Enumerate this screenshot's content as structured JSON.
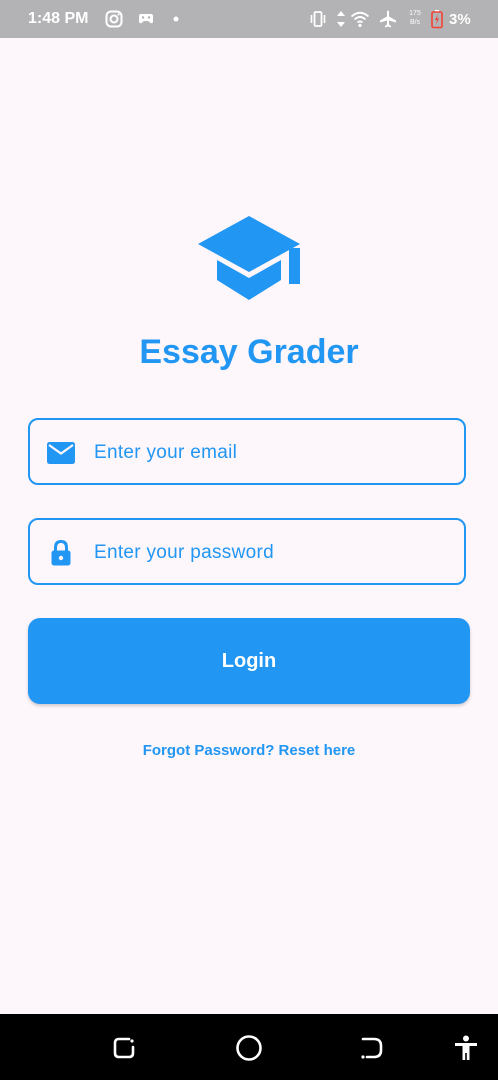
{
  "status_bar": {
    "time": "1:48 PM",
    "net_speed_value": "175",
    "net_speed_unit": "B/s",
    "battery_percent": "3%",
    "icons": [
      "instagram-icon",
      "gamepad-icon",
      "dot-icon",
      "vibrate-icon",
      "data-arrows-icon",
      "wifi-icon",
      "airplane-icon",
      "battery-low-icon"
    ]
  },
  "app": {
    "logo_icon": "graduation-cap-icon",
    "title": "Essay Grader"
  },
  "form": {
    "email": {
      "icon": "mail-icon",
      "placeholder": "Enter your email",
      "value": ""
    },
    "password": {
      "icon": "lock-icon",
      "placeholder": "Enter your password",
      "value": ""
    },
    "login_label": "Login",
    "forgot_password_label": "Forgot Password? Reset here"
  },
  "nav_bar": {
    "buttons": [
      "recents-icon",
      "home-icon",
      "back-icon",
      "accessibility-icon"
    ]
  },
  "colors": {
    "accent": "#2196f3",
    "background": "#fdf6fb",
    "status_bar": "#b3b2b4",
    "nav_bar": "#000000",
    "battery_warning": "#f44336"
  }
}
